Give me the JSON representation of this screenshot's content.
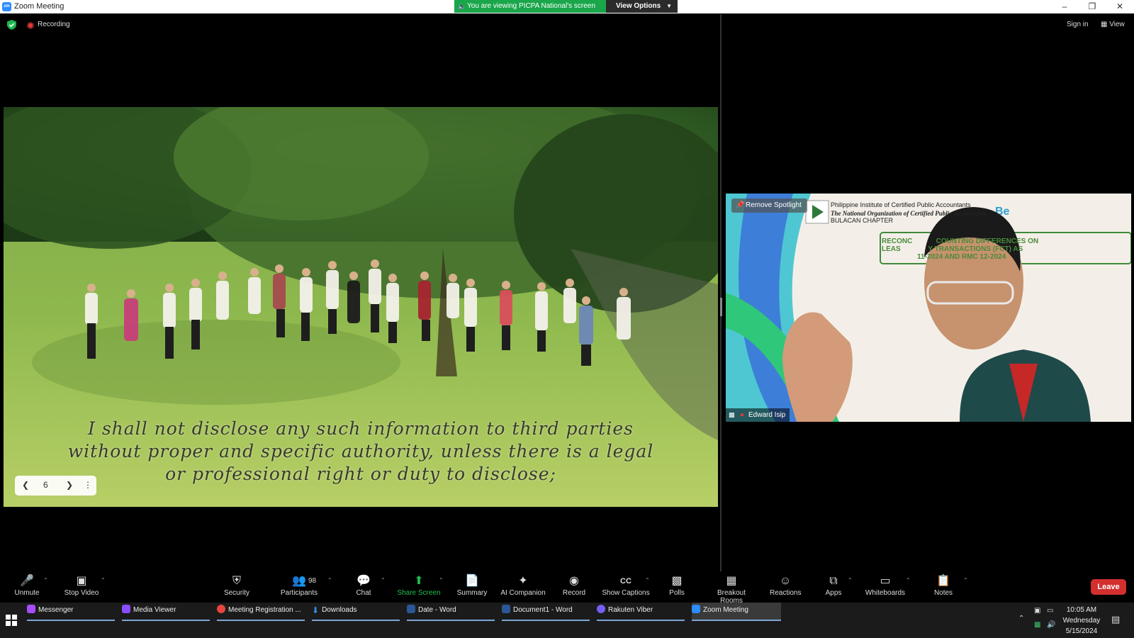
{
  "window": {
    "title": "Zoom Meeting",
    "viewing_banner": "You are viewing PICPA National's screen",
    "view_options": "View Options"
  },
  "top": {
    "recording": "Recording",
    "sign_in": "Sign in",
    "view": "View"
  },
  "share": {
    "caption_lines": [
      "I shall not disclose any such information to third parties",
      "without proper and specific authority, unless there is a legal",
      "or professional right or duty to disclose;"
    ],
    "page_number": "6"
  },
  "speaker": {
    "remove_spotlight": "Remove Spotlight",
    "org_line1": "Philippine Institute of Certified Public Accountants",
    "org_line2": "The National Organization of Certified Public Accountants",
    "org_line3": "BULACAN CHAPTER",
    "banner_line1": "RECONC            COUNTING DIFFERENCES ON",
    "banner_line2": "LEAS              Y TRANSACTIONS (FCT) AS",
    "banner_line3": "                  11-2024 AND RMC 12-2024",
    "name": "Edward Isip"
  },
  "toolbar": {
    "unmute": "Unmute",
    "stop_video": "Stop Video",
    "security": "Security",
    "participants": "Participants",
    "participants_count": "98",
    "chat": "Chat",
    "share_screen": "Share Screen",
    "summary": "Summary",
    "ai_companion": "AI Companion",
    "record": "Record",
    "show_captions": "Show Captions",
    "polls": "Polls",
    "breakout_rooms": "Breakout Rooms",
    "reactions": "Reactions",
    "apps": "Apps",
    "whiteboards": "Whiteboards",
    "notes": "Notes",
    "leave": "Leave"
  },
  "taskbar": {
    "items": [
      "Messenger",
      "Media Viewer",
      "Meeting Registration ...",
      "Downloads",
      "Date - Word",
      "Document1 - Word",
      "Rakuten Viber",
      "Zoom Meeting"
    ],
    "time": "10:05 AM",
    "day": "Wednesday",
    "date": "5/15/2024"
  },
  "colors": {
    "share_green": "#1fc050",
    "leave_red": "#d32f2f",
    "banner_green": "#1aa64a"
  }
}
